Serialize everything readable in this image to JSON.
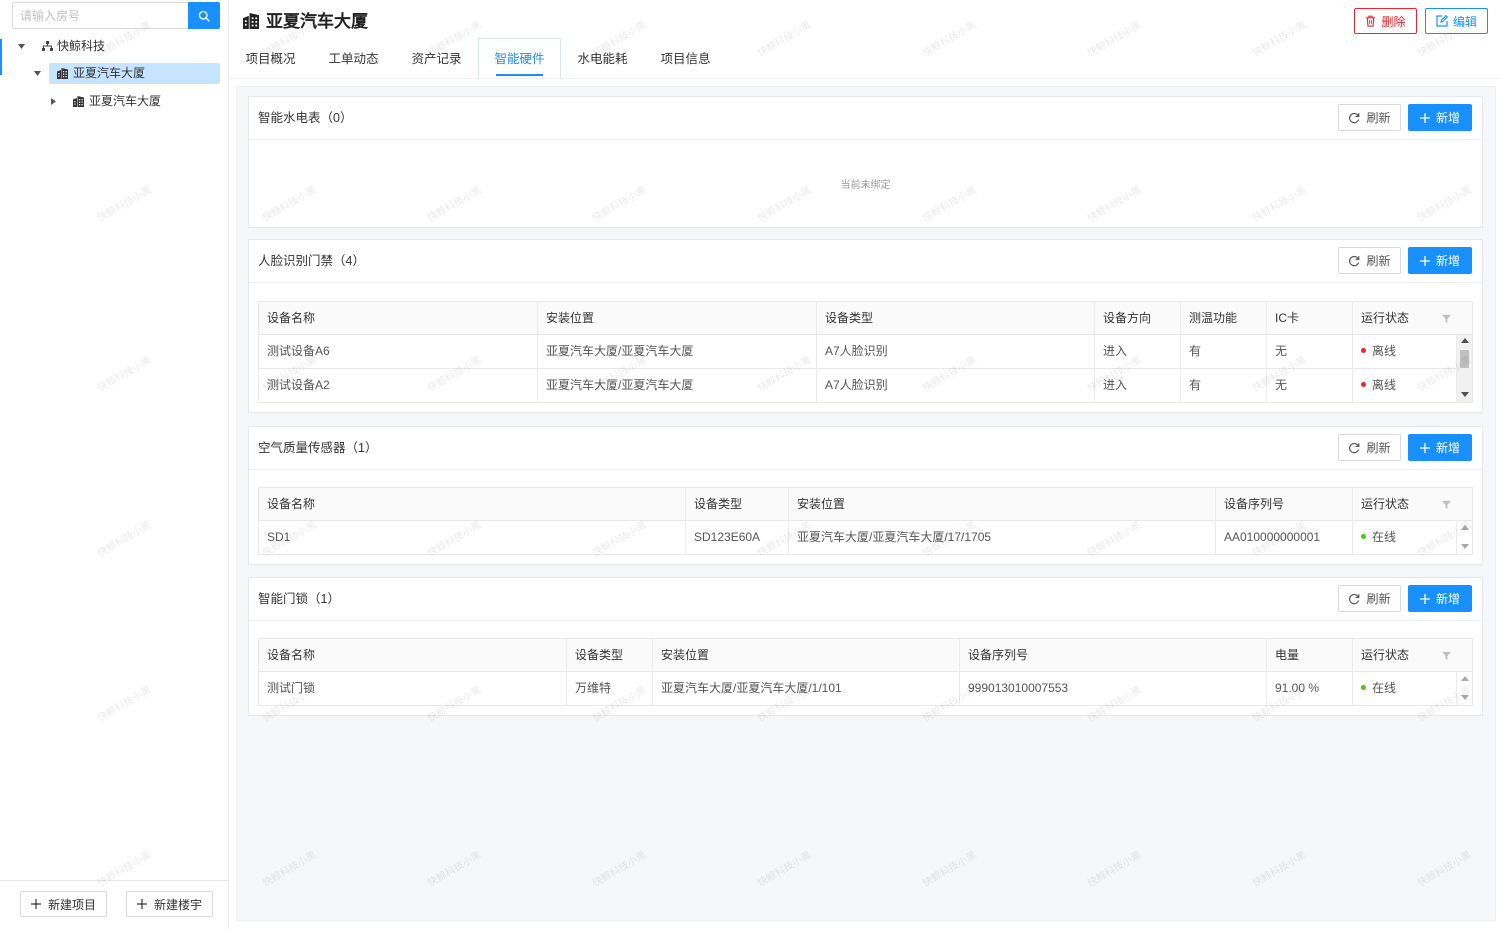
{
  "sidebar": {
    "search": {
      "placeholder": "请输入房号"
    },
    "tree": [
      {
        "label": "快鲸科技",
        "icon": "org-tree-icon",
        "expanded": true,
        "selected": false
      },
      {
        "label": "亚夏汽车大厦",
        "icon": "building-icon",
        "expanded": true,
        "selected": true
      },
      {
        "label": "亚夏汽车大厦",
        "icon": "building-icon",
        "expanded": false,
        "selected": false
      }
    ],
    "buttons": {
      "new_project": "新建项目",
      "new_building": "新建楼宇"
    }
  },
  "header": {
    "title": "亚夏汽车大厦",
    "delete_label": "删除",
    "edit_label": "编辑"
  },
  "tabs": [
    {
      "label": "项目概况",
      "active": false
    },
    {
      "label": "工单动态",
      "active": false
    },
    {
      "label": "资产记录",
      "active": false
    },
    {
      "label": "智能硬件",
      "active": true
    },
    {
      "label": "水电能耗",
      "active": false
    },
    {
      "label": "项目信息",
      "active": false
    }
  ],
  "sections": {
    "water_meter": {
      "title": "智能水电表（0）",
      "refresh_label": "刷新",
      "add_label": "新增",
      "empty_text": "当前未绑定"
    },
    "face_access": {
      "title": "人脸识别门禁（4）",
      "refresh_label": "刷新",
      "add_label": "新增",
      "columns": [
        "设备名称",
        "安装位置",
        "设备类型",
        "设备方向",
        "测温功能",
        "IC卡",
        "运行状态"
      ],
      "rows": [
        [
          "测试设备A6",
          "亚夏汽车大厦/亚夏汽车大厦",
          "A7人脸识别",
          "进入",
          "有",
          "无",
          "离线"
        ],
        [
          "测试设备A2",
          "亚夏汽车大厦/亚夏汽车大厦",
          "A7人脸识别",
          "进入",
          "有",
          "无",
          "离线"
        ]
      ]
    },
    "air_sensor": {
      "title": "空气质量传感器（1）",
      "refresh_label": "刷新",
      "add_label": "新增",
      "columns": [
        "设备名称",
        "设备类型",
        "安装位置",
        "设备序列号",
        "运行状态"
      ],
      "rows": [
        [
          "SD1",
          "SD123E60A",
          "亚夏汽车大厦/亚夏汽车大厦/17/1705",
          "AA010000000001",
          "在线"
        ]
      ]
    },
    "door_lock": {
      "title": "智能门锁（1）",
      "refresh_label": "刷新",
      "add_label": "新增",
      "columns": [
        "设备名称",
        "设备类型",
        "安装位置",
        "设备序列号",
        "电量",
        "运行状态"
      ],
      "rows": [
        [
          "测试门锁",
          "万维特",
          "亚夏汽车大厦/亚夏汽车大厦/1/101",
          "999013010007553",
          "91.00 %",
          "在线"
        ]
      ]
    }
  },
  "status_colors": {
    "离线": "#f5222d",
    "在线": "#52c41a"
  },
  "colors": {
    "primary": "#1890ff",
    "danger": "#f5222d",
    "selected_row": "#c6e3ff"
  },
  "watermark": "快鲸科技小黑"
}
